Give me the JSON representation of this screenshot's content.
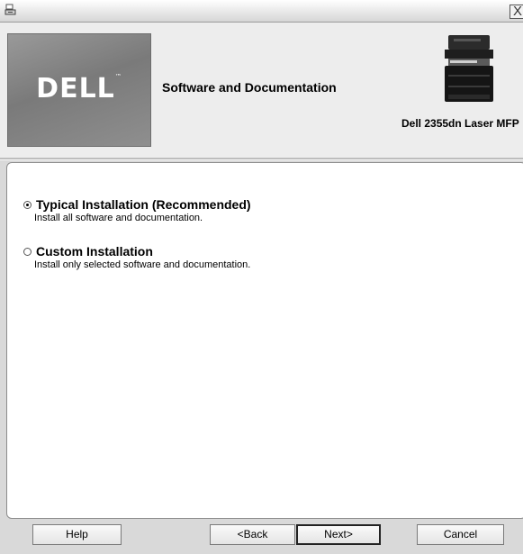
{
  "titlebar": {
    "close_glyph": "X",
    "icon": "installer-icon"
  },
  "header": {
    "logo_text": "DELL",
    "logo_tm": "™",
    "title": "Software and Documentation",
    "model": "Dell 2355dn Laser MFP",
    "printer_icon": "printer-image"
  },
  "options": [
    {
      "title": "Typical Installation (Recommended)",
      "description": "Install all software and documentation.",
      "selected": true
    },
    {
      "title": "Custom Installation",
      "description": "Install only selected software and documentation.",
      "selected": false
    }
  ],
  "buttons": {
    "help": "Help",
    "back": "<Back",
    "next": "Next>",
    "cancel": "Cancel"
  }
}
